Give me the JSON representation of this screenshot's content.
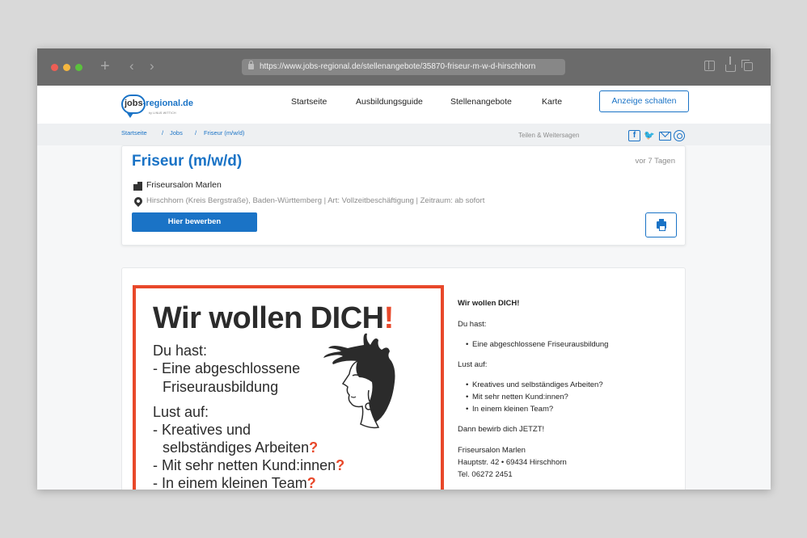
{
  "browser": {
    "url": "https://www.jobs-regional.de/stellenangebote/35870-friseur-m-w-d-hirschhorn"
  },
  "header": {
    "logo_main": "jobs",
    "logo_accent": "-regional.de",
    "logo_sub": "by LINUS WITTICH",
    "nav": [
      "Startseite",
      "Ausbildungsguide",
      "Stellenangebote",
      "Karte"
    ],
    "cta_label": "Anzeige schalten"
  },
  "breadcrumb": {
    "items": [
      "Startseite",
      "Jobs",
      "Friseur (m/w/d)"
    ],
    "separator": "/",
    "share_label": "Teilen & Weitersagen"
  },
  "job": {
    "title": "Friseur (m/w/d)",
    "age": "vor 7 Tagen",
    "company": "Friseursalon Marlen",
    "location": "Hirschhorn (Kreis Bergstraße), Baden-Württemberg | Art: Vollzeitbeschäftigung | Zeitraum: ab sofort",
    "apply_label": "Hier bewerben"
  },
  "poster": {
    "title": "Wir wollen DICH",
    "title_excl": "!",
    "lines": [
      {
        "text": "Du hast:",
        "q": ""
      },
      {
        "text": "- Eine abgeschlossene",
        "q": ""
      },
      {
        "text": "  Friseurausbildung",
        "q": ""
      },
      {
        "text": "Lust auf:",
        "q": ""
      },
      {
        "text": "- Kreatives und",
        "q": ""
      },
      {
        "text": "  selbständiges Arbeiten",
        "q": "?"
      },
      {
        "text": "- Mit sehr netten Kund:innen",
        "q": "?"
      },
      {
        "text": "- In einem kleinen Team",
        "q": "?"
      }
    ]
  },
  "description": {
    "headline": "Wir wollen DICH!",
    "du_hast": "Du hast:",
    "du_hast_items": [
      "Eine abgeschlossene Friseurausbildung"
    ],
    "lust_auf": "Lust auf:",
    "lust_auf_items": [
      "Kreatives und selbständiges Arbeiten?",
      "Mit sehr netten Kund:innen?",
      "In einem kleinen Team?"
    ],
    "cta": "Dann bewirb dich JETZT!",
    "contact": [
      "Friseursalon Marlen",
      "Hauptstr. 42 • 69434 Hirschhorn",
      "Tel. 06272 2451"
    ]
  },
  "colors": {
    "brand_blue": "#1a73c6",
    "poster_accent": "#e8482a"
  }
}
